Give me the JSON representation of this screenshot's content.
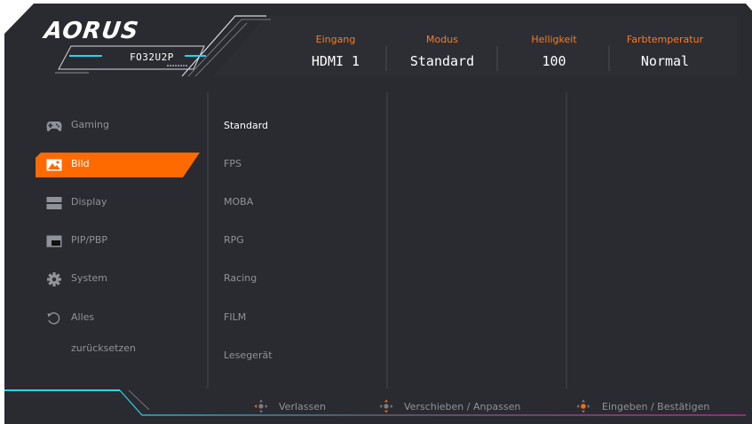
{
  "brand": {
    "logo": "AORUS",
    "model": "FO32U2P"
  },
  "header": {
    "items": [
      {
        "label": "Eingang",
        "value": "HDMI 1"
      },
      {
        "label": "Modus",
        "value": "Standard"
      },
      {
        "label": "Helligkeit",
        "value": "100"
      },
      {
        "label": "Farbtemperatur",
        "value": "Normal"
      }
    ]
  },
  "menu": {
    "items": [
      {
        "label": "Gaming",
        "icon": "gamepad-icon"
      },
      {
        "label": "Bild",
        "icon": "picture-icon",
        "active": true
      },
      {
        "label": "Display",
        "icon": "display-icon"
      },
      {
        "label": "PIP/PBP",
        "icon": "pip-icon"
      },
      {
        "label": "System",
        "icon": "gear-icon"
      },
      {
        "label": "Alles",
        "label2": "zurücksetzen",
        "icon": "reset-icon"
      }
    ]
  },
  "submenu": {
    "options": [
      "Standard",
      "FPS",
      "MOBA",
      "RPG",
      "Racing",
      "FILM",
      "Lesegerät"
    ],
    "selected": "Standard"
  },
  "footer": {
    "hints": [
      {
        "label": "Verlassen",
        "icon": "joystick-left-icon"
      },
      {
        "label": "Verschieben / Anpassen",
        "icon": "joystick-updown-icon"
      },
      {
        "label": "Eingeben / Bestätigen",
        "icon": "joystick-press-icon"
      }
    ]
  },
  "colors": {
    "background": "#2a2b30",
    "accent": "#ff6a00",
    "cyan": "#27d3f0",
    "magenta": "#d92aa6",
    "text_dim": "#8f9299",
    "label_orange": "#ff7a1a"
  }
}
